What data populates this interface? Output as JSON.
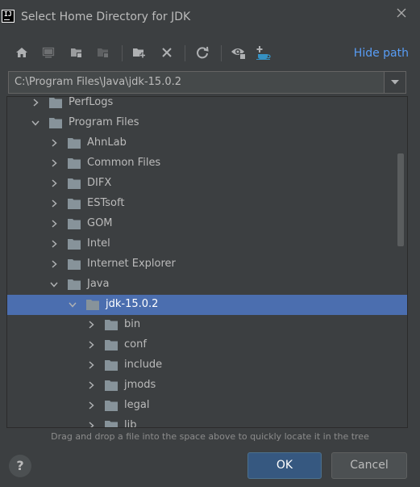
{
  "window": {
    "title": "Select Home Directory for JDK",
    "app_icon_text": "IJ"
  },
  "toolbar": {
    "icons": [
      "home-icon",
      "desktop-icon",
      "project-icon",
      "module-icon",
      "new-folder-icon",
      "delete-icon",
      "refresh-icon",
      "show-hidden-icon",
      "download-jdk-icon"
    ],
    "hide_path_label": "Hide path"
  },
  "path": {
    "value": "C:\\Program Files\\Java\\jdk-15.0.2"
  },
  "tree": {
    "rows": [
      {
        "label": "PerfLogs",
        "depth": 1,
        "expanded": false,
        "selected": false
      },
      {
        "label": "Program Files",
        "depth": 1,
        "expanded": true,
        "selected": false
      },
      {
        "label": "AhnLab",
        "depth": 2,
        "expanded": false,
        "selected": false
      },
      {
        "label": "Common Files",
        "depth": 2,
        "expanded": false,
        "selected": false
      },
      {
        "label": "DIFX",
        "depth": 2,
        "expanded": false,
        "selected": false
      },
      {
        "label": "ESTsoft",
        "depth": 2,
        "expanded": false,
        "selected": false
      },
      {
        "label": "GOM",
        "depth": 2,
        "expanded": false,
        "selected": false
      },
      {
        "label": "Intel",
        "depth": 2,
        "expanded": false,
        "selected": false
      },
      {
        "label": "Internet Explorer",
        "depth": 2,
        "expanded": false,
        "selected": false
      },
      {
        "label": "Java",
        "depth": 2,
        "expanded": true,
        "selected": false
      },
      {
        "label": "jdk-15.0.2",
        "depth": 3,
        "expanded": true,
        "selected": true
      },
      {
        "label": "bin",
        "depth": 4,
        "expanded": false,
        "selected": false
      },
      {
        "label": "conf",
        "depth": 4,
        "expanded": false,
        "selected": false
      },
      {
        "label": "include",
        "depth": 4,
        "expanded": false,
        "selected": false
      },
      {
        "label": "jmods",
        "depth": 4,
        "expanded": false,
        "selected": false
      },
      {
        "label": "legal",
        "depth": 4,
        "expanded": false,
        "selected": false
      },
      {
        "label": "lib",
        "depth": 4,
        "expanded": false,
        "selected": false
      }
    ]
  },
  "hint": "Drag and drop a file into the space above to quickly locate it in the tree",
  "buttons": {
    "help_label": "?",
    "ok_label": "OK",
    "cancel_label": "Cancel"
  },
  "colors": {
    "background": "#3c3f41",
    "selection": "#4b6eaf",
    "link": "#589df6",
    "ok_button": "#365880"
  }
}
